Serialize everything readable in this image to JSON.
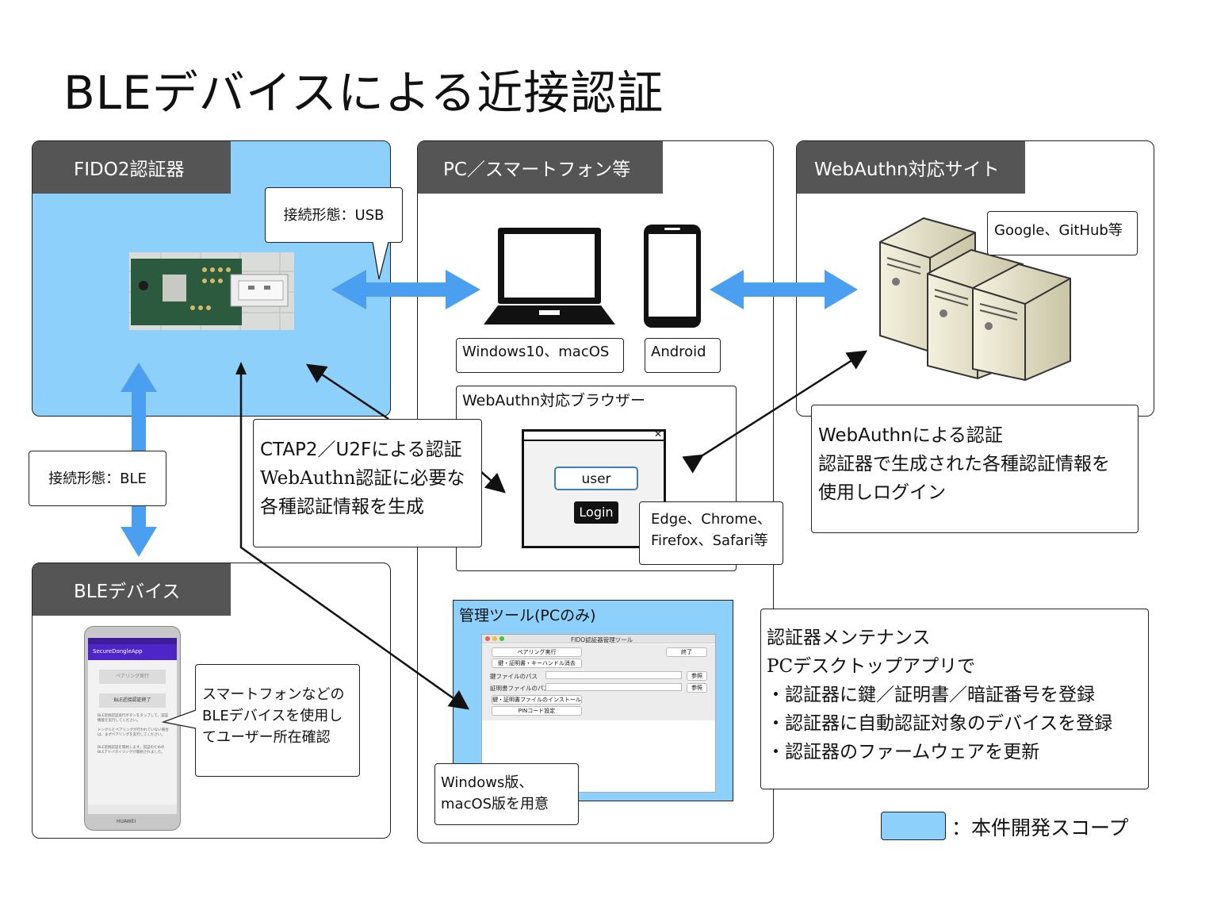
{
  "title": "BLEデバイスによる近接認証",
  "sections": {
    "fido2": "FIDO2認証器",
    "pc": "PC／スマートフォン等",
    "webauthn_site": "WebAuthn対応サイト",
    "ble_device": "BLEデバイス"
  },
  "callouts": {
    "usb": "接続形態：USB",
    "ble": "接続形態：BLE",
    "windows": "Windows10、macOS",
    "android": "Android",
    "google": "Google、GitHub等",
    "browsers_line1": "Edge、Chrome、",
    "browsers_line2": "Firefox、Safari等",
    "ctap_line1": "CTAP2／U2Fによる認証",
    "ctap_line2": "WebAuthn認証に必要な",
    "ctap_line3": "各種認証情報を生成",
    "webauthn_auth_line1": "WebAuthnによる認証",
    "webauthn_auth_line2": "認証器で生成された各種認証情報を",
    "webauthn_auth_line3": "使用しログイン",
    "smartphone_line1": "スマートフォンなどの",
    "smartphone_line2": "BLEデバイスを使用し",
    "smartphone_line3": "てユーザー所在確認",
    "versions_line1": "Windows版、",
    "versions_line2": "macOS版を用意",
    "maint_line1": "認証器メンテナンス",
    "maint_line2": "PCデスクトップアプリで",
    "maint_line3": "・認証器に鍵／証明書／暗証番号を登録",
    "maint_line4": "・認証器に自動認証対象のデバイスを登録",
    "maint_line5": "・認証器のファームウェアを更新"
  },
  "browser_box": {
    "label": "WebAuthn対応ブラウザー",
    "user_field": "user",
    "login_button": "Login"
  },
  "admin_tool": {
    "label": "管理ツール(PCのみ)",
    "window_title": "FIDO認証器管理ツール",
    "pairing_button": "ペアリング実行",
    "exit_button": "終了",
    "erase_button": "鍵・証明書・キーハンドル消去",
    "key_path_label": "鍵ファイルのパス",
    "cert_path_label": "証明書ファイルのパス",
    "browse_button": "参照",
    "install_button": "鍵・証明書ファイルのインストール",
    "pin_button": "PINコード設定"
  },
  "phone_app": {
    "app_name": "SecureDongleApp",
    "pairing_button": "ペアリング実行",
    "ble_close_button": "BLE近接認証終了",
    "text1": "BLE近接認証実行ボタンをタップして、認証機能を実行してください。",
    "text2": "ドングルとペアリングが行われていない場合は、まずペアリングを実行してください。",
    "text3": "BLE近接認証を開始します。認証のためのBLEアドバタイジングが開始されました。",
    "brand": "HUAWEI"
  },
  "legend": {
    "label": "：本件開発スコープ",
    "color": "#8dd0fb"
  },
  "colors": {
    "scope": "#8dd0fb",
    "arrow_blue": "#4a9ff0",
    "header_gray": "#555555"
  }
}
